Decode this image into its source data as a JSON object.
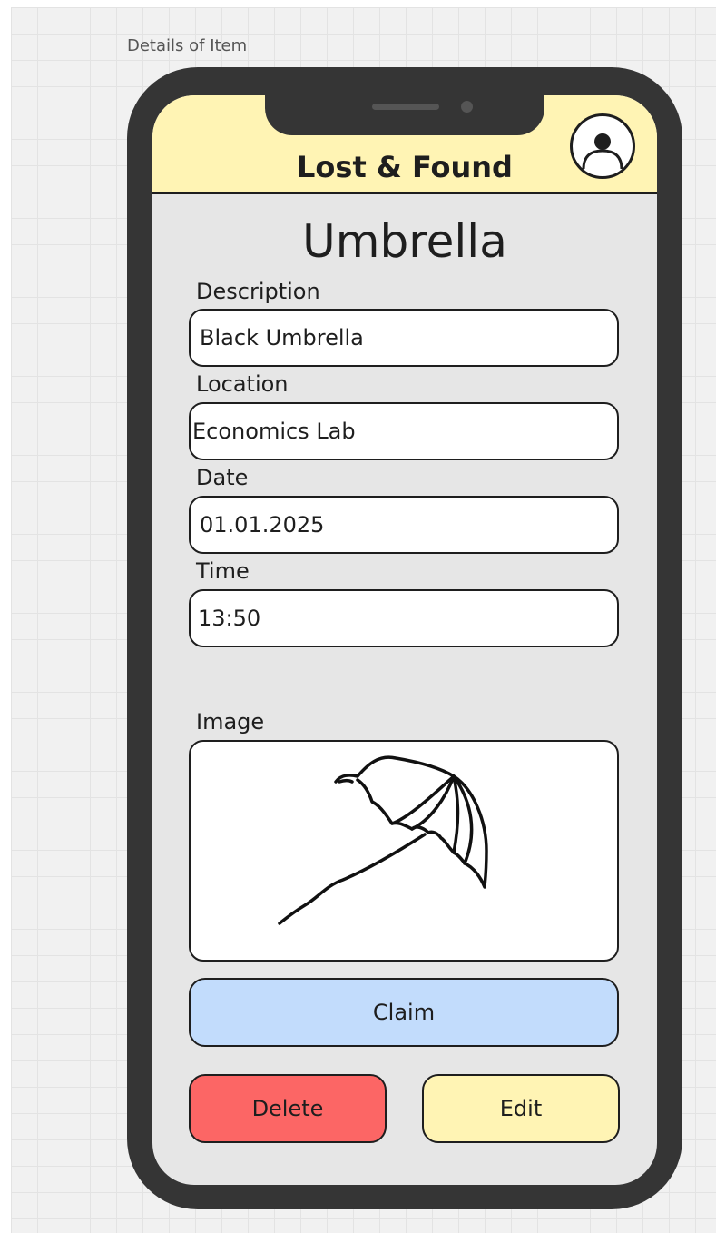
{
  "canvas": {
    "frame_label": "Details of Item"
  },
  "header": {
    "app_title": "Lost & Found",
    "profile_icon": "user-avatar-icon"
  },
  "item": {
    "title": "Umbrella",
    "fields": {
      "description": {
        "label": "Description",
        "value": "Black Umbrella"
      },
      "location": {
        "label": "Location",
        "value": "Economics Lab"
      },
      "date": {
        "label": "Date",
        "value": "01.01.2025"
      },
      "time": {
        "label": "Time",
        "value": "13:50"
      }
    },
    "image": {
      "label": "Image",
      "icon": "umbrella-sketch-icon"
    }
  },
  "actions": {
    "claim_label": "Claim",
    "delete_label": "Delete",
    "edit_label": "Edit"
  },
  "colors": {
    "header_bg": "#fff4b4",
    "claim_bg": "#c2dcfc",
    "delete_bg": "#fc6665",
    "edit_bg": "#fff4b4",
    "phone_frame": "#353535",
    "screen_bg": "#e6e6e6"
  }
}
